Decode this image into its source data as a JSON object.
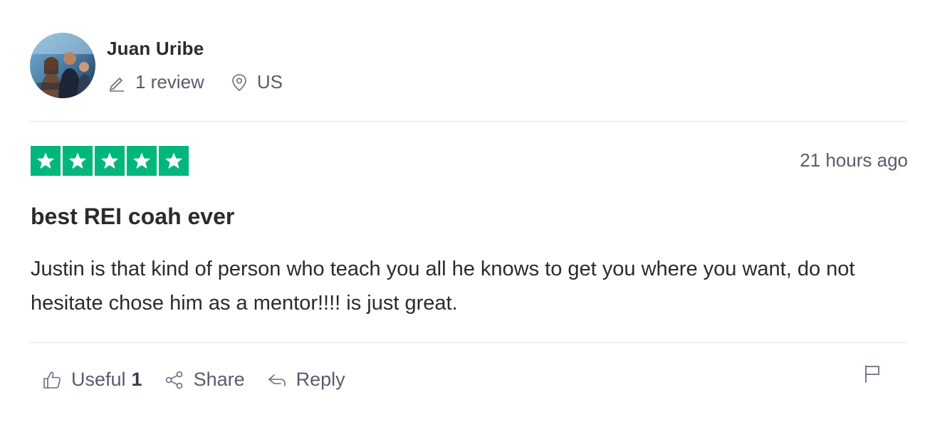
{
  "reviewer": {
    "name": "Juan Uribe",
    "review_count": "1 review",
    "country": "US"
  },
  "review": {
    "rating": 5,
    "rating_max": 5,
    "time_ago": "21 hours ago",
    "title": "best REI coah ever",
    "body": "Justin is that kind of person who teach you all he knows to get you where you want, do not hesitate chose him as a mentor!!!! is just great."
  },
  "actions": {
    "useful_label": "Useful",
    "useful_count": "1",
    "share_label": "Share",
    "reply_label": "Reply"
  },
  "icons": {
    "review_count": "pencil-icon",
    "country": "location-pin-icon",
    "useful": "thumbs-up-icon",
    "share": "share-icon",
    "reply": "reply-icon",
    "report": "flag-icon",
    "star": "star-icon"
  },
  "colors": {
    "star_fill": "#00b67a",
    "text_primary": "#2b2b2b",
    "text_secondary": "#5a5a6e",
    "divider": "#e5e5e5"
  }
}
